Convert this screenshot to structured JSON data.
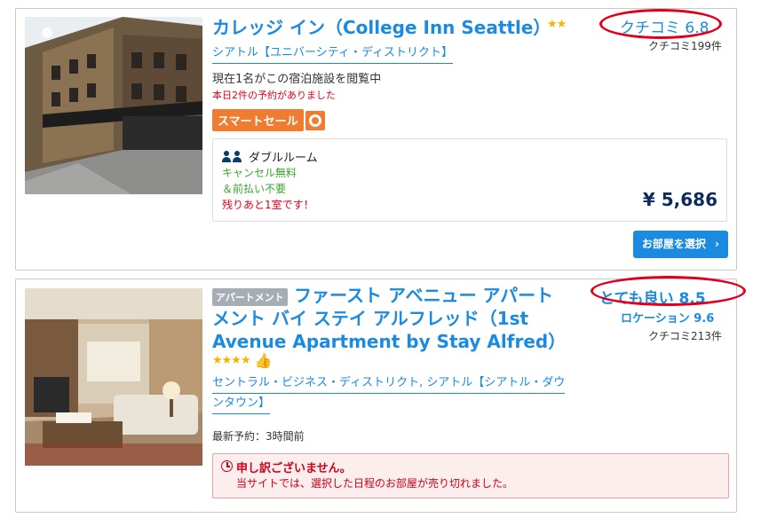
{
  "hotels": [
    {
      "name": "カレッジ イン（College Inn Seattle）",
      "stars": "★★",
      "location": "シアトル【ユニバーシティ・ディストリクト】",
      "score_label": "クチコミ 6.8",
      "review_count": "クチコミ199件",
      "viewing": "現在1名がこの宿泊施設を閲覧中",
      "booked_today": "本日2件の予約がありました",
      "smart_sale": "スマートセール",
      "room": {
        "type": "ダブルルーム",
        "cancel": "キャンセル無料",
        "prepay": "＆前払い不要",
        "remaining": "残りあと1室です！",
        "price": "¥ 5,686",
        "select_button": "お部屋を選択"
      }
    },
    {
      "badge": "アパートメント",
      "name": "ファースト アベニュー アパートメント バイ ステイ アルフレッド（1st Avenue Apartment by Stay Alfred）",
      "stars": "★★★★",
      "location_line1": "セントラル・ビジネス・ディストリクト, シアトル【シアトル・ダウ",
      "location_line2": "ンタウン】",
      "score_label": "とても良い 8.5",
      "location_score": "ロケーション 9.6",
      "review_count": "クチコミ213件",
      "last_booking": "最新予約：3時間前",
      "sold_out_title": "申し訳ございません。",
      "sold_out_text": "当サイトでは、選択した日程のお部屋が売り切れました。"
    }
  ],
  "colors": {
    "link": "#1a8be0",
    "alert_red": "#e0001b",
    "sale_orange": "#ef7c30",
    "cancel_green": "#3aa531"
  }
}
